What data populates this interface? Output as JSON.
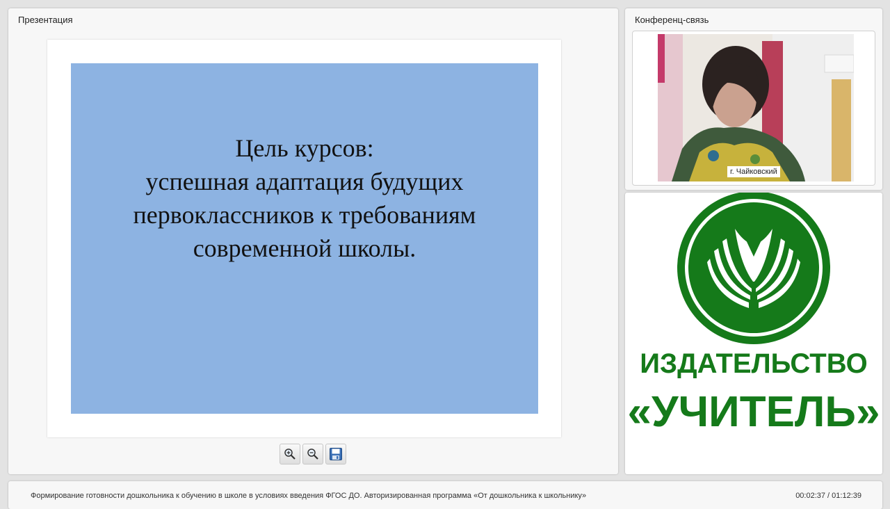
{
  "presentation": {
    "title": "Презентация",
    "slide": {
      "lines": [
        "Цель курсов:",
        "успешная адаптация будущих",
        "первоклассников к требованиям",
        "современной школы."
      ],
      "background": "#8db3e2"
    },
    "toolbar": {
      "zoom_in_icon": "zoom-in-icon",
      "zoom_out_icon": "zoom-out-icon",
      "save_icon": "save-icon"
    }
  },
  "conference": {
    "title": "Конференц-связь",
    "location_label": "г. Чайковский"
  },
  "logo": {
    "line1": "ИЗДАТЕЛЬСТВО",
    "line2": "«УЧИТЕЛЬ»",
    "color": "#157a1a"
  },
  "footer": {
    "course_title": "Формирование готовности дошкольника к обучению в школе в условиях введения ФГОС ДО. Авторизированная программа «От дошкольника к школьнику»",
    "time": "00:02:37 / 01:12:39"
  }
}
